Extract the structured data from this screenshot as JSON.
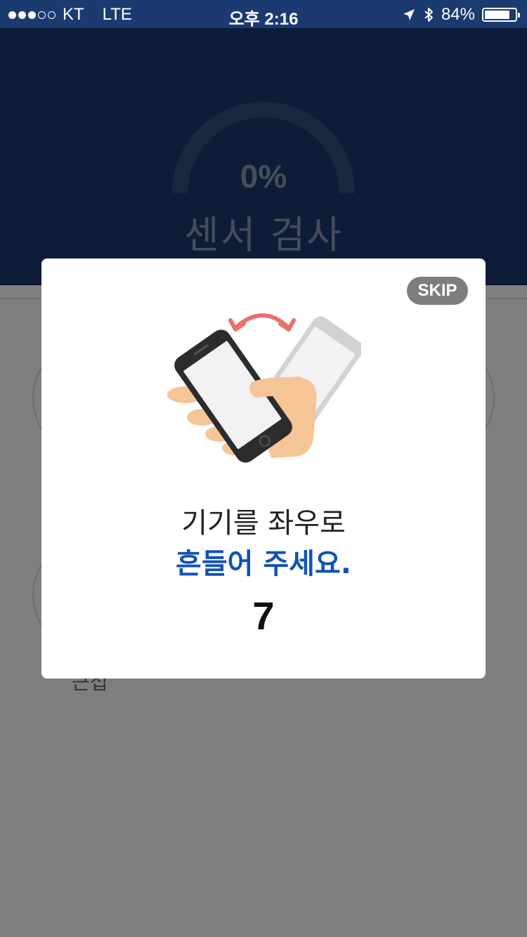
{
  "status_bar": {
    "carrier": "KT",
    "network": "LTE",
    "time": "오후 2:16",
    "battery_text": "84%",
    "battery_level": 0.84,
    "signal_bars_filled": 3,
    "signal_bars_total": 5
  },
  "header": {
    "progress_text": "0%",
    "progress_value": 0,
    "title": "센서 검사",
    "background_color": "#1b3a70"
  },
  "background_content": {
    "partial_label": "근접"
  },
  "modal": {
    "skip_label": "SKIP",
    "instruction_line1": "기기를 좌우로",
    "instruction_line2": "흔들어 주세요.",
    "countdown": "7",
    "accent_color": "#1252b3",
    "illustration": "shake-phone-icon"
  }
}
